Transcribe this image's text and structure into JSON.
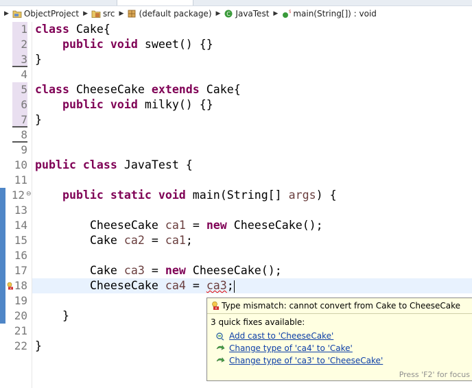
{
  "breadcrumb": {
    "project": "ObjectProject",
    "folder": "src",
    "package": "(default package)",
    "class": "JavaTest",
    "method": "main(String[]) : void"
  },
  "line_numbers": [
    "1",
    "2",
    "3",
    "4",
    "5",
    "6",
    "7",
    "8",
    "9",
    "10",
    "11",
    "12",
    "13",
    "14",
    "15",
    "16",
    "17",
    "18",
    "19",
    "20",
    "21",
    "22"
  ],
  "code": {
    "l1": {
      "kw": "class",
      "rest": " Cake{"
    },
    "l2": {
      "kw": "public void",
      "rest": " sweet() {}"
    },
    "l3": {
      "rest": "}"
    },
    "l5": {
      "kw1": "class",
      "mid": " CheeseCake ",
      "kw2": "extends",
      "rest": " Cake{"
    },
    "l6": {
      "kw": "public void",
      "rest": " milky() {}"
    },
    "l7": {
      "rest": "}"
    },
    "l10": {
      "kw": "public class",
      "rest": " JavaTest {"
    },
    "l12": {
      "kw": "public static void",
      "rest1": " main(String[] ",
      "var": "args",
      "rest2": ") {"
    },
    "l14": {
      "type": "CheeseCake ",
      "var": "ca1",
      "mid": " = ",
      "kw": "new",
      "rest": " CheeseCake();"
    },
    "l15": {
      "type": "Cake ",
      "var": "ca2",
      "mid": " = ",
      "var2": "ca1",
      "rest": ";"
    },
    "l17": {
      "type": "Cake ",
      "var": "ca3",
      "mid": " = ",
      "kw": "new",
      "rest": " CheeseCake();"
    },
    "l18": {
      "type": "CheeseCake ",
      "var": "ca4",
      "mid": " = ",
      "err": "ca3",
      "rest": ";"
    },
    "l20": {
      "rest": "}"
    },
    "l22": {
      "rest": "}"
    }
  },
  "quickfix": {
    "header": "Type mismatch: cannot convert from Cake to CheeseCake",
    "subheader": "3 quick fixes available:",
    "fixes": [
      {
        "label": "Add cast to 'CheeseCake'",
        "icon": "cast-icon"
      },
      {
        "label": "Change type of 'ca4' to 'Cake'",
        "icon": "change-icon"
      },
      {
        "label": "Change type of 'ca3' to 'CheeseCake'",
        "icon": "change-icon"
      }
    ],
    "footer": "Press 'F2' for focus"
  },
  "colors": {
    "keyword": "#7f0055",
    "variable": "#6a3e3e",
    "link": "#0c3ea7",
    "popup_bg": "#ffffe1",
    "current_line": "#e8f2fe",
    "quickdiff_blue": "#4f86c7"
  }
}
